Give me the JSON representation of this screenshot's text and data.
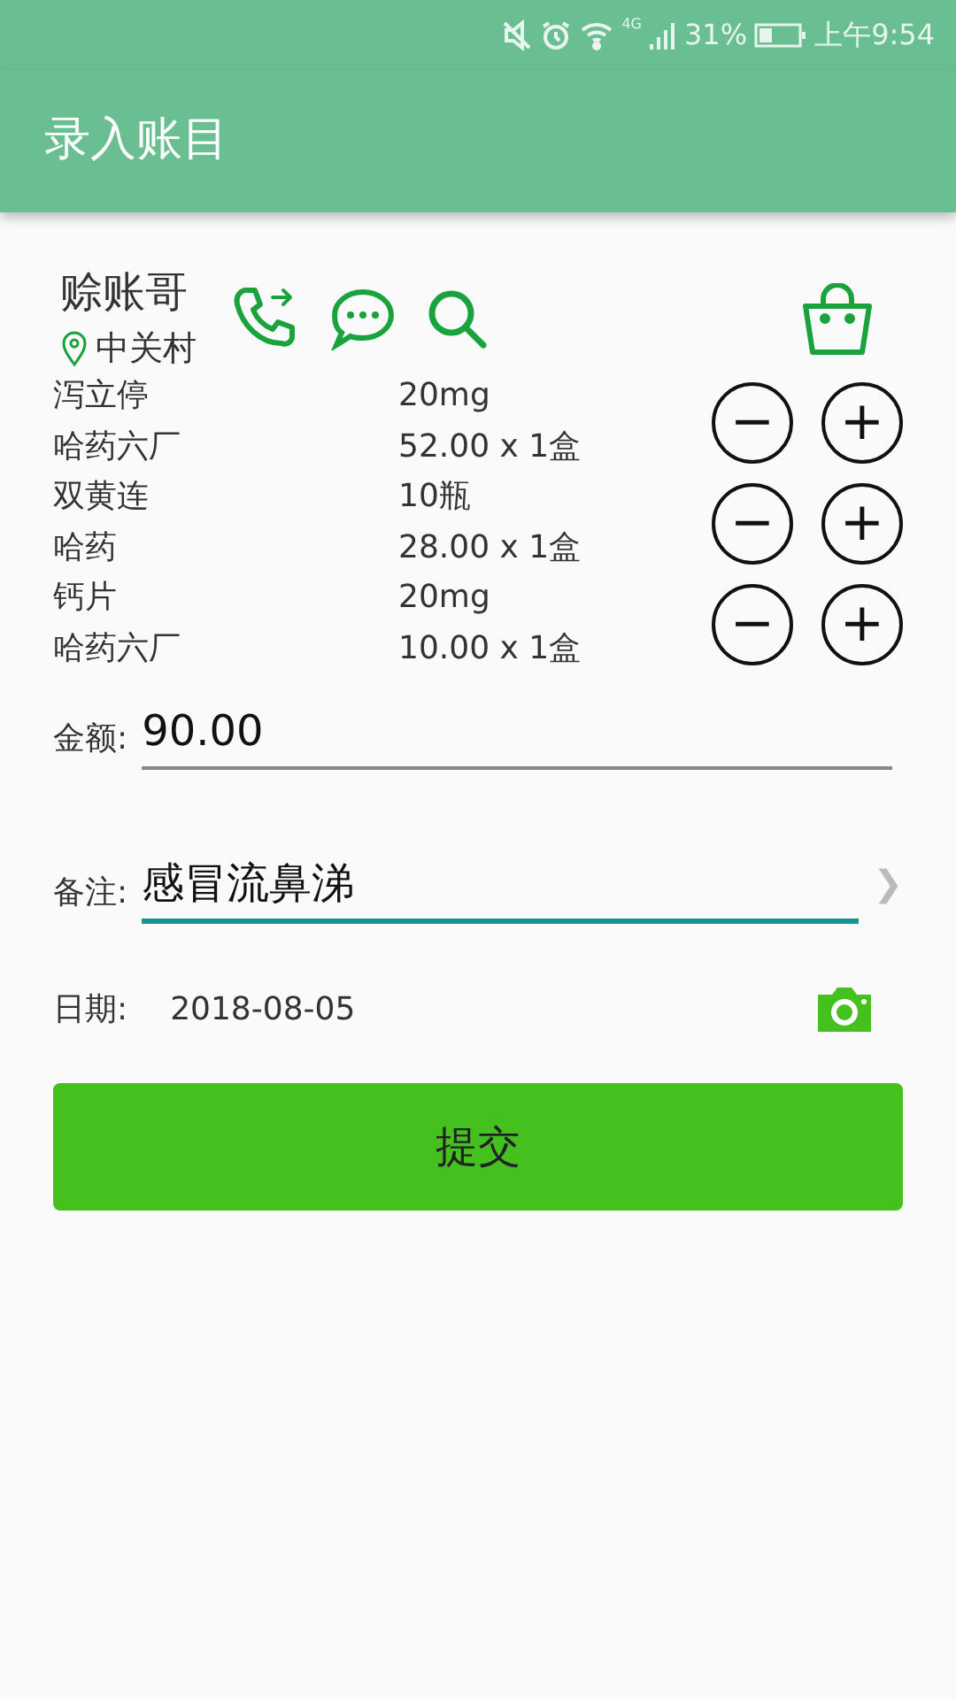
{
  "status_bar": {
    "network": "4G",
    "battery": {
      "text": "31%"
    },
    "time": "上午9:54"
  },
  "app_bar": {
    "title": "录入账目"
  },
  "customer": {
    "name": "赊账哥",
    "location": "中关村"
  },
  "items": [
    {
      "name": "泻立停",
      "spec": "20mg",
      "maker": "哈药六厂",
      "price": "52.00 x 1盒",
      "minus": "−",
      "plus": "+"
    },
    {
      "name": "双黄连",
      "spec": "10瓶",
      "maker": "哈药",
      "price": "28.00 x 1盒",
      "minus": "−",
      "plus": "+"
    },
    {
      "name": "钙片",
      "spec": "20mg",
      "maker": "哈药六厂",
      "price": "10.00 x 1盒",
      "minus": "−",
      "plus": "+"
    }
  ],
  "amount": {
    "label": "金额:",
    "value": "90.00",
    "focused": false
  },
  "note": {
    "label": "备注:",
    "value": "感冒流鼻涕",
    "focused": true,
    "arrow": "❯"
  },
  "date": {
    "label": "日期:",
    "value": "2018-08-05"
  },
  "submit": {
    "label": "提交"
  }
}
